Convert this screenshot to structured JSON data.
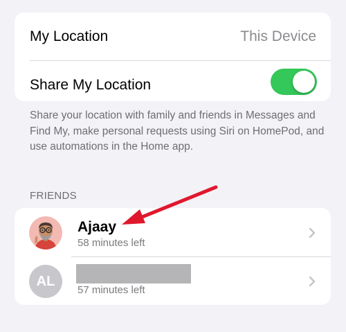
{
  "settings": {
    "my_location_label": "My Location",
    "my_location_value": "This Device",
    "share_location_label": "Share My Location",
    "share_location_enabled": true,
    "footer": "Share your location with family and friends in Messages and Find My, make personal requests using Siri on HomePod, and use automations in the Home app."
  },
  "friends": {
    "header": "FRIENDS",
    "items": [
      {
        "name": "Ajaay",
        "subtitle": "58 minutes left",
        "avatar": "memoji-avatar"
      },
      {
        "name": "",
        "initials": "AL",
        "subtitle": "57 minutes left"
      }
    ]
  },
  "colors": {
    "background": "#f2f2f7",
    "toggle_on": "#34c759",
    "annotation_arrow": "#e0182d"
  }
}
